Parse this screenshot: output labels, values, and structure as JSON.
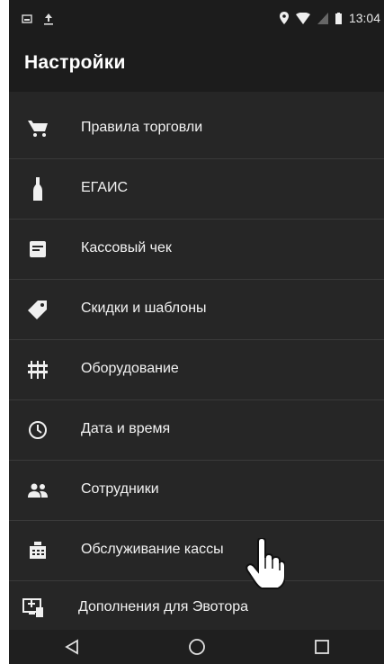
{
  "status_bar": {
    "time": "13:04"
  },
  "app_bar": {
    "title": "Настройки"
  },
  "settings": {
    "items": [
      {
        "label": "Правила торговли",
        "icon": "cart-icon"
      },
      {
        "label": "ЕГАИС",
        "icon": "bottle-icon"
      },
      {
        "label": "Кассовый чек",
        "icon": "receipt-icon"
      },
      {
        "label": "Скидки и шаблоны",
        "icon": "tag-icon"
      },
      {
        "label": "Оборудование",
        "icon": "equipment-icon"
      },
      {
        "label": "Дата и время",
        "icon": "clock-icon"
      },
      {
        "label": "Сотрудники",
        "icon": "people-icon"
      },
      {
        "label": "Обслуживание кассы",
        "icon": "register-icon"
      },
      {
        "label": "Дополнения для Эвотора",
        "icon": "addons-icon"
      }
    ]
  },
  "nav_bar": {
    "buttons": [
      "back-icon",
      "home-icon",
      "recents-icon"
    ]
  },
  "colors": {
    "background": "#262626",
    "bar": "#1c1c1c",
    "text": "#ffffff",
    "divider": "#3a3a3a"
  }
}
